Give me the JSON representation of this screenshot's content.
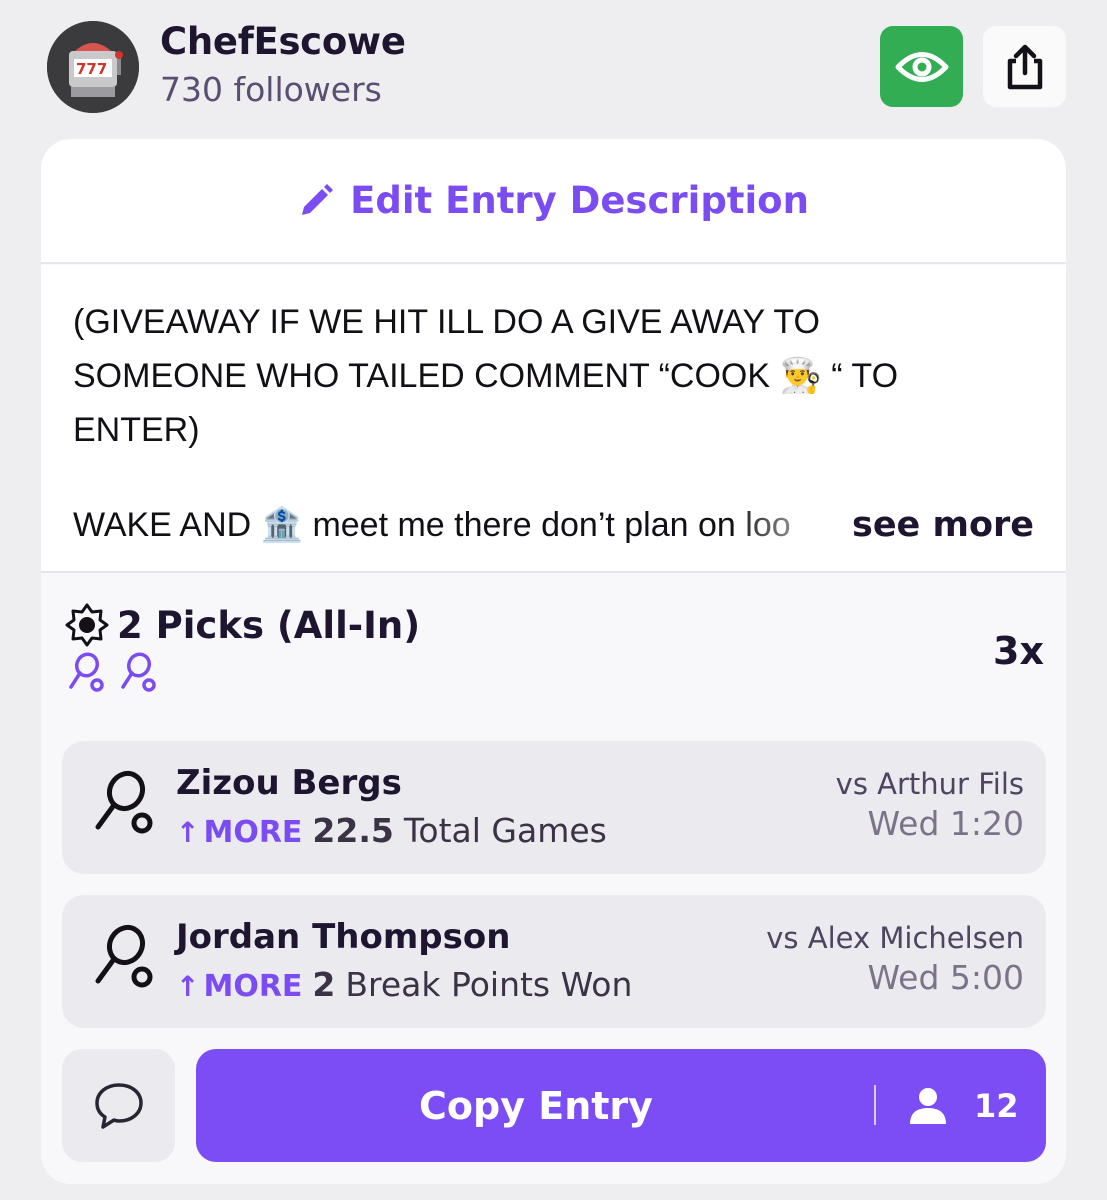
{
  "header": {
    "username": "ChefEscowe",
    "followers": "730 followers",
    "avatar_icon": "slot-machine-icon",
    "watch_icon": "eye-icon",
    "share_icon": "share-icon"
  },
  "entry": {
    "edit_label": "Edit Entry Description",
    "description_lines": "(GIVEAWAY IF WE HIT ILL DO A GIVE AWAY TO\nSOMEONE WHO TAILED COMMENT “COOK 👨‍🍳 “ TO\nENTER)",
    "description_last_line": "WAKE AND 🏦 meet me there don’t plan on loo",
    "see_more": "see more"
  },
  "picks": {
    "title": "2 Picks (All-In)",
    "multiplier": "3x",
    "items": [
      {
        "player": "Zizou Bergs",
        "direction": "MORE",
        "value": "22.5",
        "stat": "Total Games",
        "opponent": "vs Arthur Fils",
        "time": "Wed 1:20"
      },
      {
        "player": "Jordan Thompson",
        "direction": "MORE",
        "value": "2",
        "stat": "Break Points Won",
        "opponent": "vs Alex Michelsen",
        "time": "Wed 5:00"
      }
    ]
  },
  "actions": {
    "copy_label": "Copy Entry",
    "copy_count": "12"
  },
  "colors": {
    "accent": "#7c4df4",
    "watch_green": "#32ad54",
    "background": "#eeeef0"
  }
}
